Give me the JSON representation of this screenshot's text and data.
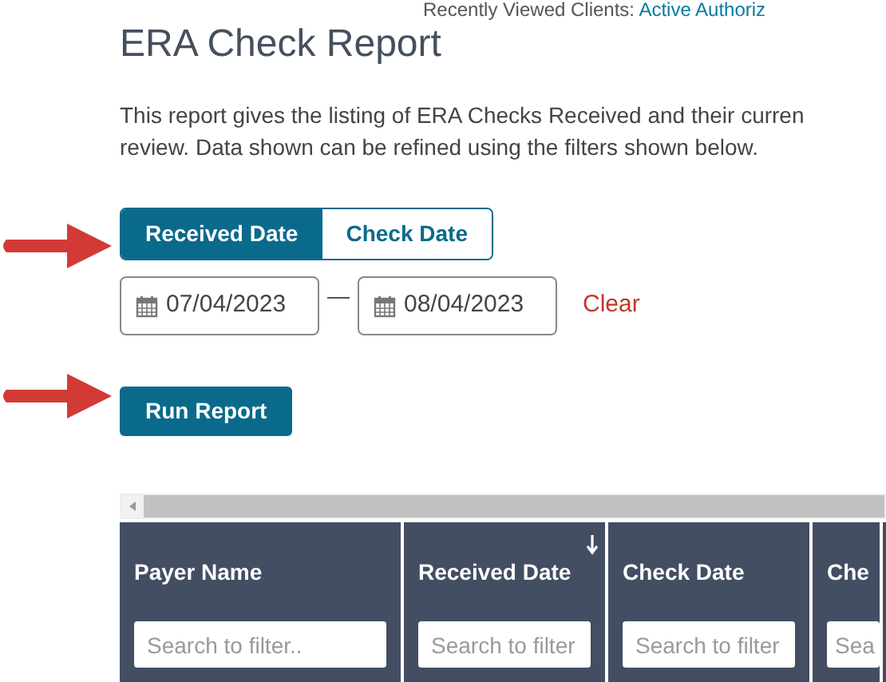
{
  "recent": {
    "label": "Recently Viewed Clients:",
    "link": "Active Authoriz"
  },
  "title": "ERA Check Report",
  "description": [
    "This report gives the listing of ERA Checks Received and their curren",
    "review. Data shown can be refined using the filters shown below."
  ],
  "date_type_tabs": [
    {
      "label": "Received Date",
      "selected": true
    },
    {
      "label": "Check Date",
      "selected": false
    }
  ],
  "date_from": "07/04/2023",
  "date_separator": "—",
  "date_to": "08/04/2023",
  "clear": "Clear",
  "run_button": "Run Report",
  "table": {
    "columns": [
      {
        "label": "Payer Name",
        "placeholder": "Search to filter..",
        "sorted": false
      },
      {
        "label": "Received Date",
        "placeholder": "Search to filter",
        "sorted": true
      },
      {
        "label": "Check Date",
        "placeholder": "Search to filter",
        "sorted": false
      },
      {
        "label": "Che",
        "placeholder": "Sea",
        "sorted": false
      }
    ]
  }
}
